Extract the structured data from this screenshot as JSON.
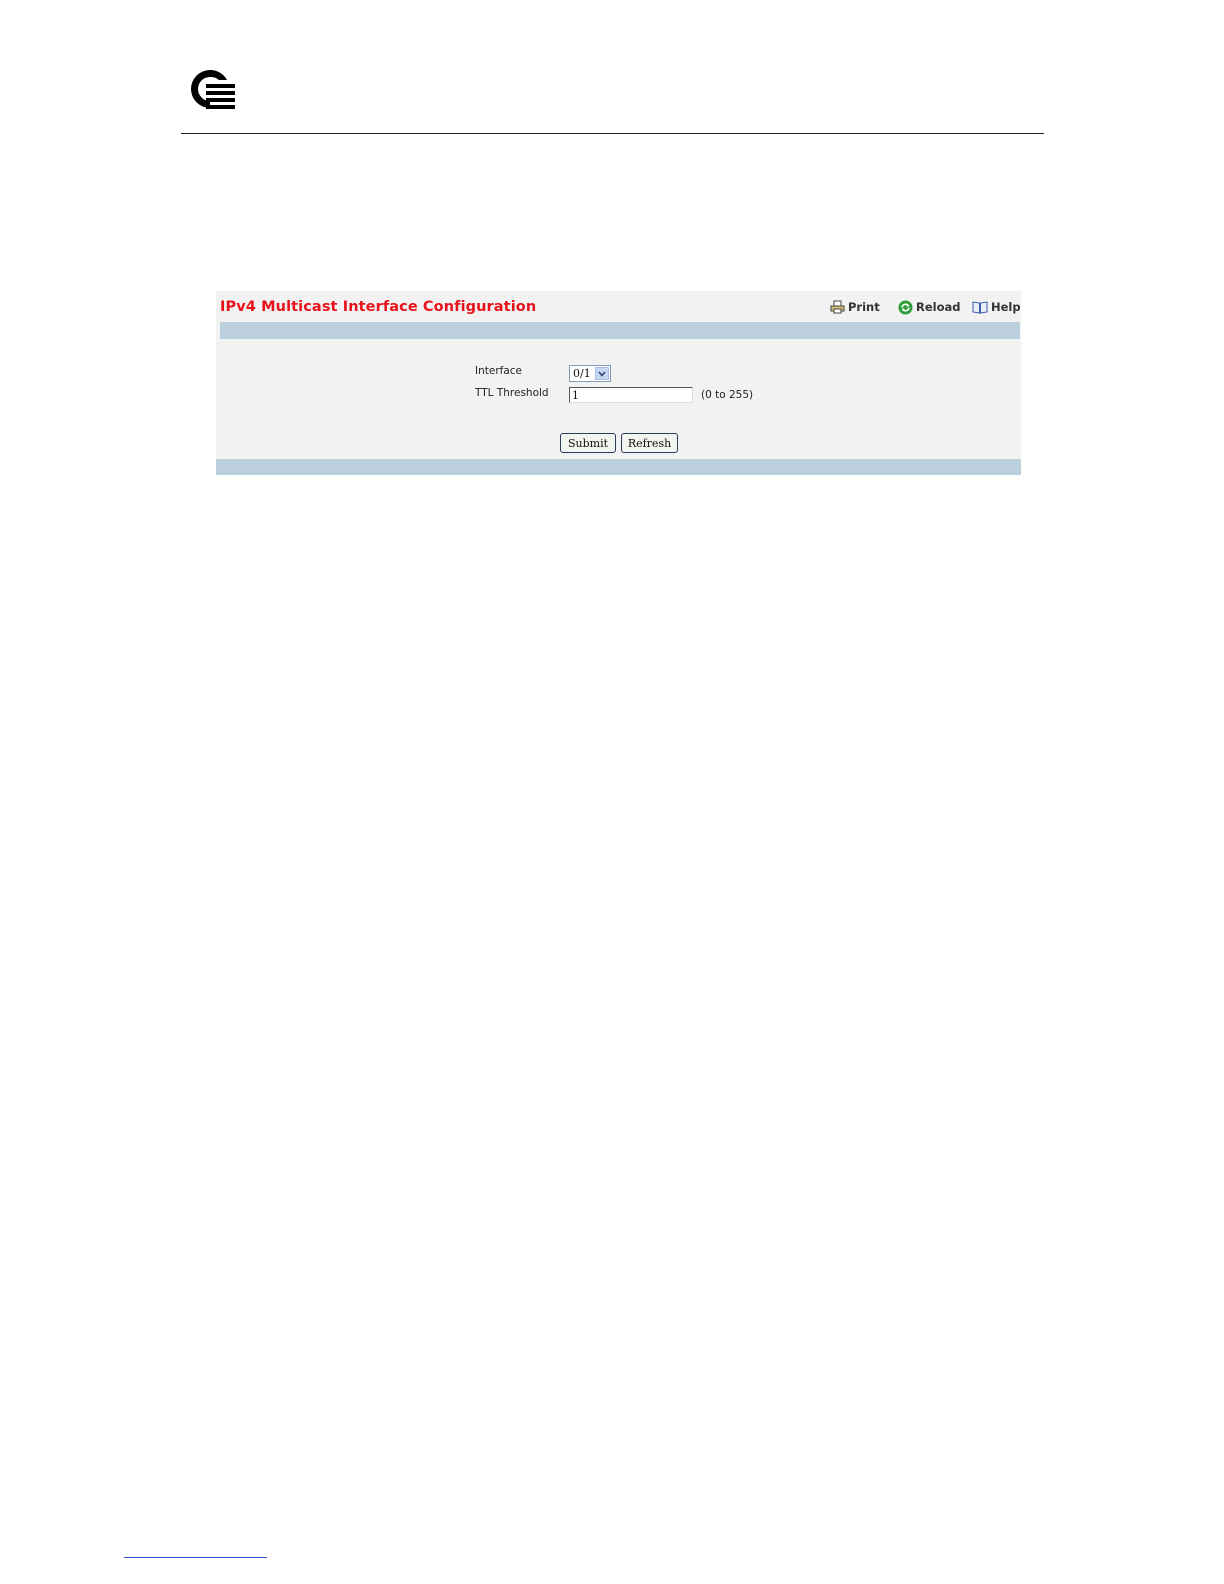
{
  "page": {
    "title": "IPv4 Multicast Interface Configuration"
  },
  "toolbar": {
    "print_label": "Print",
    "reload_label": "Reload",
    "help_label": "Help"
  },
  "form": {
    "interface": {
      "label": "Interface",
      "selected": "0/1"
    },
    "ttl_threshold": {
      "label": "TTL Threshold",
      "value": "1",
      "range_hint": "(0 to 255)"
    }
  },
  "actions": {
    "submit_label": "Submit",
    "refresh_label": "Refresh"
  },
  "colors": {
    "title": "#e8121b",
    "band": "#bccfdc",
    "panel": "#f2f2f2"
  },
  "icons": {
    "logo": "brand-logo-icon",
    "print": "printer-icon",
    "reload": "reload-icon",
    "help": "book-icon"
  }
}
